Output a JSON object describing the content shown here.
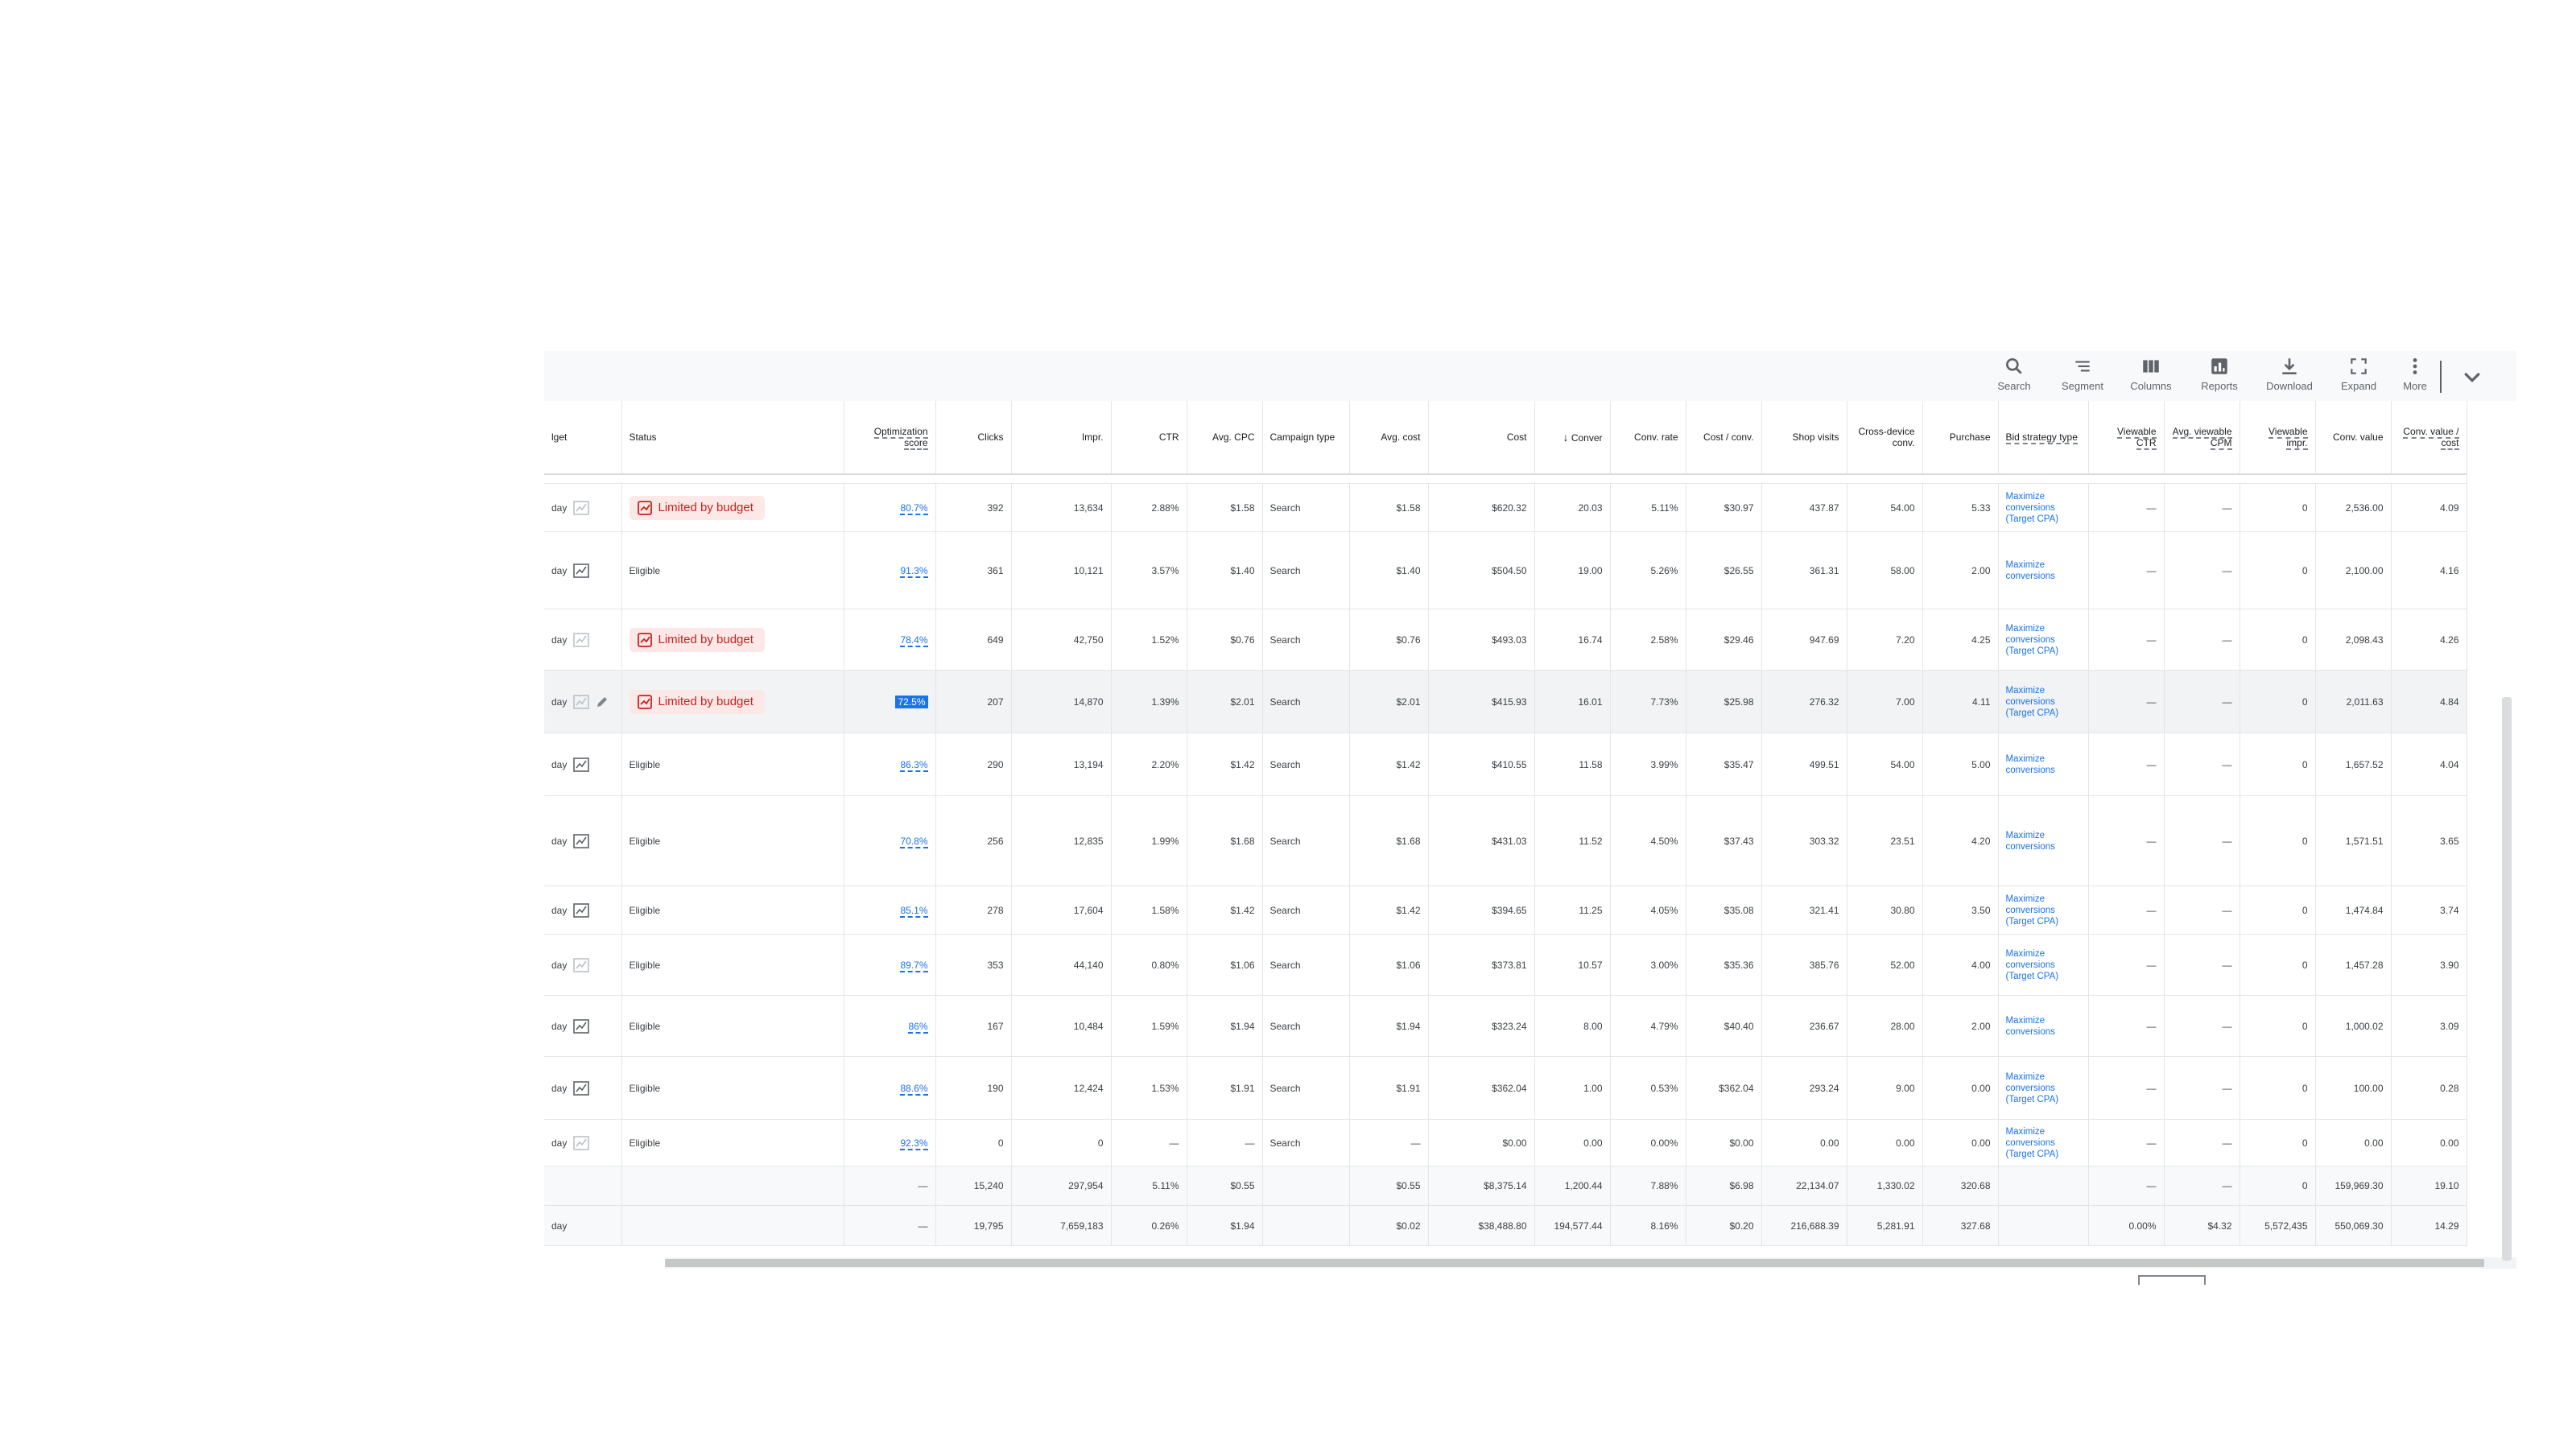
{
  "toolbar": {
    "search": "Search",
    "segment": "Segment",
    "columns": "Columns",
    "reports": "Reports",
    "download": "Download",
    "expand": "Expand",
    "more": "More"
  },
  "headers": {
    "budget": "lget",
    "status": "Status",
    "optimization_score": "Optimization score",
    "clicks": "Clicks",
    "impr": "Impr.",
    "ctr": "CTR",
    "avg_cpc": "Avg. CPC",
    "campaign_type": "Campaign type",
    "avg_cost": "Avg. cost",
    "cost": "Cost",
    "conversions": "Conver",
    "conv_rate": "Conv. rate",
    "cost_per_conv": "Cost / conv.",
    "shop_visits": "Shop visits",
    "cross_device": "Cross-device conv.",
    "purchase": "Purchase",
    "bid_strategy": "Bid strategy type",
    "viewable_ctr": "Viewable CTR",
    "avg_viewable_cpm": "Avg. viewable CPM",
    "viewable_impr": "Viewable impr.",
    "conv_value": "Conv. value",
    "conv_value_cost": "Conv. value / cost"
  },
  "rows": [
    {
      "budget": "day",
      "status": "Limited by budget",
      "limited": true,
      "opt": "80.7%",
      "clicks": "392",
      "impr": "13,634",
      "ctr": "2.88%",
      "avg_cpc": "$1.58",
      "type": "Search",
      "avg_cost": "$1.58",
      "cost": "$620.32",
      "conv": "20.03",
      "conv_rate": "5.11%",
      "cost_conv": "$30.97",
      "shop": "437.87",
      "cross": "54.00",
      "purchase": "5.33",
      "strategy": "Maximize conversions (Target CPA)",
      "vctr": "—",
      "vcpm": "—",
      "vimpr": "0",
      "cval": "2,536.00",
      "cvc": "4.09"
    },
    {
      "budget": "day",
      "status": "Eligible",
      "limited": false,
      "opt": "91.3%",
      "clicks": "361",
      "impr": "10,121",
      "ctr": "3.57%",
      "avg_cpc": "$1.40",
      "type": "Search",
      "avg_cost": "$1.40",
      "cost": "$504.50",
      "conv": "19.00",
      "conv_rate": "5.26%",
      "cost_conv": "$26.55",
      "shop": "361.31",
      "cross": "58.00",
      "purchase": "2.00",
      "strategy": "Maximize conversions",
      "vctr": "—",
      "vcpm": "—",
      "vimpr": "0",
      "cval": "2,100.00",
      "cvc": "4.16"
    },
    {
      "budget": "day",
      "status": "Limited by budget",
      "limited": true,
      "opt": "78.4%",
      "clicks": "649",
      "impr": "42,750",
      "ctr": "1.52%",
      "avg_cpc": "$0.76",
      "type": "Search",
      "avg_cost": "$0.76",
      "cost": "$493.03",
      "conv": "16.74",
      "conv_rate": "2.58%",
      "cost_conv": "$29.46",
      "shop": "947.69",
      "cross": "7.20",
      "purchase": "4.25",
      "strategy": "Maximize conversions (Target CPA)",
      "vctr": "—",
      "vcpm": "—",
      "vimpr": "0",
      "cval": "2,098.43",
      "cvc": "4.26"
    },
    {
      "budget": "day",
      "status": "Limited by budget",
      "limited": true,
      "opt": "72.5%",
      "clicks": "207",
      "impr": "14,870",
      "ctr": "1.39%",
      "avg_cpc": "$2.01",
      "type": "Search",
      "avg_cost": "$2.01",
      "cost": "$415.93",
      "conv": "16.01",
      "conv_rate": "7.73%",
      "cost_conv": "$25.98",
      "shop": "276.32",
      "cross": "7.00",
      "purchase": "4.11",
      "strategy": "Maximize conversions (Target CPA)",
      "vctr": "—",
      "vcpm": "—",
      "vimpr": "0",
      "cval": "2,011.63",
      "cvc": "4.84"
    },
    {
      "budget": "day",
      "status": "Eligible",
      "limited": false,
      "opt": "86.3%",
      "clicks": "290",
      "impr": "13,194",
      "ctr": "2.20%",
      "avg_cpc": "$1.42",
      "type": "Search",
      "avg_cost": "$1.42",
      "cost": "$410.55",
      "conv": "11.58",
      "conv_rate": "3.99%",
      "cost_conv": "$35.47",
      "shop": "499.51",
      "cross": "54.00",
      "purchase": "5.00",
      "strategy": "Maximize conversions",
      "vctr": "—",
      "vcpm": "—",
      "vimpr": "0",
      "cval": "1,657.52",
      "cvc": "4.04"
    },
    {
      "budget": "day",
      "status": "Eligible",
      "limited": false,
      "opt": "70.8%",
      "clicks": "256",
      "impr": "12,835",
      "ctr": "1.99%",
      "avg_cpc": "$1.68",
      "type": "Search",
      "avg_cost": "$1.68",
      "cost": "$431.03",
      "conv": "11.52",
      "conv_rate": "4.50%",
      "cost_conv": "$37.43",
      "shop": "303.32",
      "cross": "23.51",
      "purchase": "4.20",
      "strategy": "Maximize conversions",
      "vctr": "—",
      "vcpm": "—",
      "vimpr": "0",
      "cval": "1,571.51",
      "cvc": "3.65"
    },
    {
      "budget": "day",
      "status": "Eligible",
      "limited": false,
      "opt": "85.1%",
      "clicks": "278",
      "impr": "17,604",
      "ctr": "1.58%",
      "avg_cpc": "$1.42",
      "type": "Search",
      "avg_cost": "$1.42",
      "cost": "$394.65",
      "conv": "11.25",
      "conv_rate": "4.05%",
      "cost_conv": "$35.08",
      "shop": "321.41",
      "cross": "30.80",
      "purchase": "3.50",
      "strategy": "Maximize conversions (Target CPA)",
      "vctr": "—",
      "vcpm": "—",
      "vimpr": "0",
      "cval": "1,474.84",
      "cvc": "3.74"
    },
    {
      "budget": "day",
      "status": "Eligible",
      "limited": false,
      "opt": "89.7%",
      "clicks": "353",
      "impr": "44,140",
      "ctr": "0.80%",
      "avg_cpc": "$1.06",
      "type": "Search",
      "avg_cost": "$1.06",
      "cost": "$373.81",
      "conv": "10.57",
      "conv_rate": "3.00%",
      "cost_conv": "$35.36",
      "shop": "385.76",
      "cross": "52.00",
      "purchase": "4.00",
      "strategy": "Maximize conversions (Target CPA)",
      "vctr": "—",
      "vcpm": "—",
      "vimpr": "0",
      "cval": "1,457.28",
      "cvc": "3.90"
    },
    {
      "budget": "day",
      "status": "Eligible",
      "limited": false,
      "opt": "86%",
      "clicks": "167",
      "impr": "10,484",
      "ctr": "1.59%",
      "avg_cpc": "$1.94",
      "type": "Search",
      "avg_cost": "$1.94",
      "cost": "$323.24",
      "conv": "8.00",
      "conv_rate": "4.79%",
      "cost_conv": "$40.40",
      "shop": "236.67",
      "cross": "28.00",
      "purchase": "2.00",
      "strategy": "Maximize conversions",
      "vctr": "—",
      "vcpm": "—",
      "vimpr": "0",
      "cval": "1,000.02",
      "cvc": "3.09"
    },
    {
      "budget": "day",
      "status": "Eligible",
      "limited": false,
      "opt": "88.6%",
      "clicks": "190",
      "impr": "12,424",
      "ctr": "1.53%",
      "avg_cpc": "$1.91",
      "type": "Search",
      "avg_cost": "$1.91",
      "cost": "$362.04",
      "conv": "1.00",
      "conv_rate": "0.53%",
      "cost_conv": "$362.04",
      "shop": "293.24",
      "cross": "9.00",
      "purchase": "0.00",
      "strategy": "Maximize conversions (Target CPA)",
      "vctr": "—",
      "vcpm": "—",
      "vimpr": "0",
      "cval": "100.00",
      "cvc": "0.28"
    },
    {
      "budget": "day",
      "status": "Eligible",
      "limited": false,
      "opt": "92.3%",
      "clicks": "0",
      "impr": "0",
      "ctr": "—",
      "avg_cpc": "—",
      "type": "Search",
      "avg_cost": "—",
      "cost": "$0.00",
      "conv": "0.00",
      "conv_rate": "0.00%",
      "cost_conv": "$0.00",
      "shop": "0.00",
      "cross": "0.00",
      "purchase": "0.00",
      "strategy": "Maximize conversions (Target CPA)",
      "vctr": "—",
      "vcpm": "—",
      "vimpr": "0",
      "cval": "0.00",
      "cvc": "0.00"
    }
  ],
  "summary": [
    {
      "budget": "",
      "opt": "—",
      "clicks": "15,240",
      "impr": "297,954",
      "ctr": "5.11%",
      "avg_cpc": "$0.55",
      "avg_cost": "$0.55",
      "cost": "$8,375.14",
      "conv": "1,200.44",
      "conv_rate": "7.88%",
      "cost_conv": "$6.98",
      "shop": "22,134.07",
      "cross": "1,330.02",
      "purchase": "320.68",
      "vctr": "—",
      "vcpm": "—",
      "vimpr": "0",
      "cval": "159,969.30",
      "cvc": "19.10"
    },
    {
      "budget": "day",
      "opt": "—",
      "clicks": "19,795",
      "impr": "7,659,183",
      "ctr": "0.26%",
      "avg_cpc": "$1.94",
      "avg_cost": "$0.02",
      "cost": "$38,488.80",
      "conv": "194,577.44",
      "conv_rate": "8.16%",
      "cost_conv": "$0.20",
      "shop": "216,688.39",
      "cross": "5,281.91",
      "purchase": "327.68",
      "vctr": "0.00%",
      "vcpm": "$4.32",
      "vimpr": "5,572,435",
      "cval": "550,069.30",
      "cvc": "14.29"
    }
  ]
}
